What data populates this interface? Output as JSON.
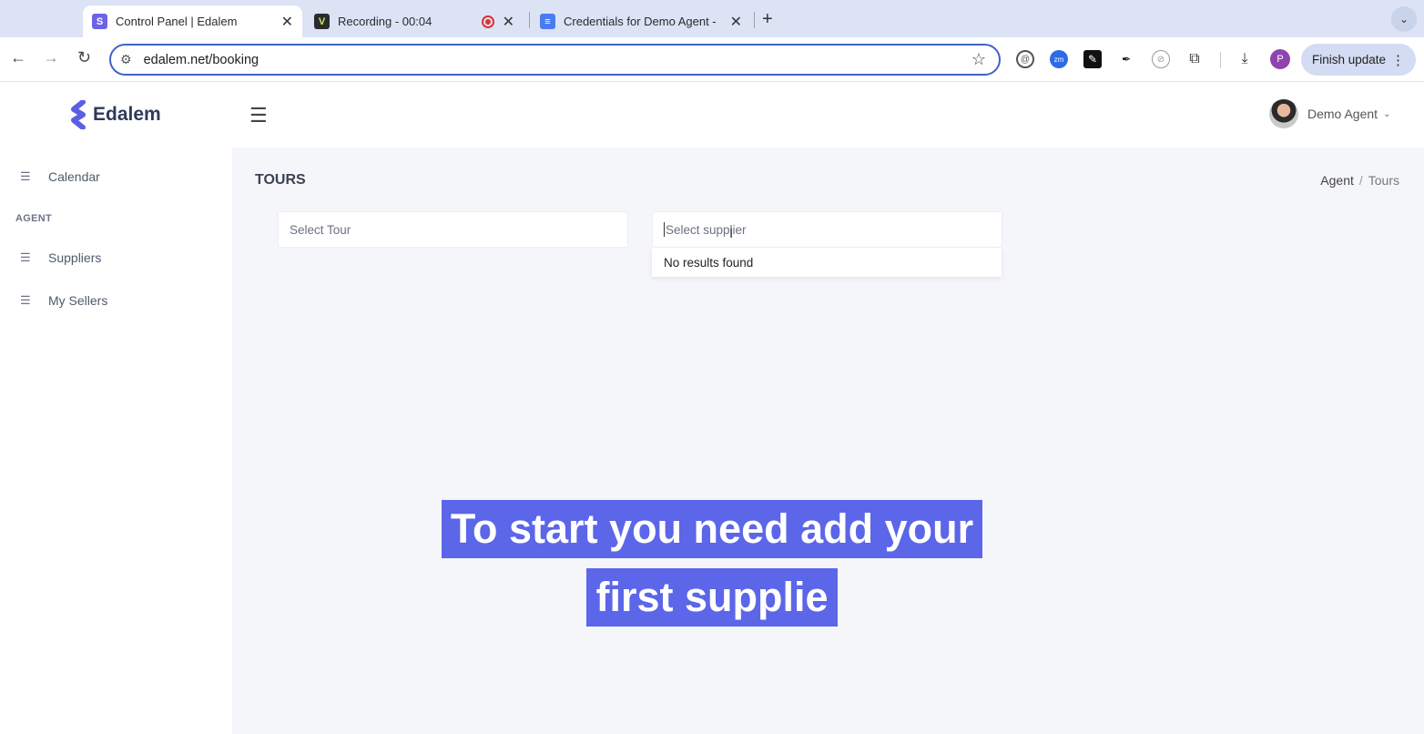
{
  "browser": {
    "tabs": [
      {
        "title": "Control Panel | Edalem",
        "active": true,
        "favicon": "edalem-favicon",
        "favicon_color": "#6c63e8"
      },
      {
        "title": "Recording - 00:04",
        "active": false,
        "favicon": "v-favicon",
        "favicon_color": "#2b2b2b"
      },
      {
        "title": "Credentials for Demo Agent -",
        "active": false,
        "favicon": "docs-favicon",
        "favicon_color": "#4a7cf0"
      }
    ],
    "new_tab": "+",
    "url": "edalem.net/booking",
    "finish_update": "Finish update",
    "profile_initial": "P"
  },
  "app": {
    "brand": "Edalem",
    "brand_color": "#5b5fe6",
    "user_name": "Demo Agent",
    "sidebar": {
      "items_top": [
        {
          "label": "Calendar"
        }
      ],
      "section_heading": "AGENT",
      "items_agent": [
        {
          "label": "Suppliers"
        },
        {
          "label": "My Sellers"
        }
      ]
    },
    "page_title": "TOURS",
    "breadcrumb": {
      "parent": "Agent",
      "current": "Tours"
    },
    "tour_select": {
      "placeholder": "Select Tour"
    },
    "supplier_select": {
      "placeholder": "Select supplier"
    },
    "dropdown_message": "No results found"
  },
  "caption": {
    "line1": "To start you need add your",
    "line2": "first supplie",
    "background": "#5b66e8"
  }
}
